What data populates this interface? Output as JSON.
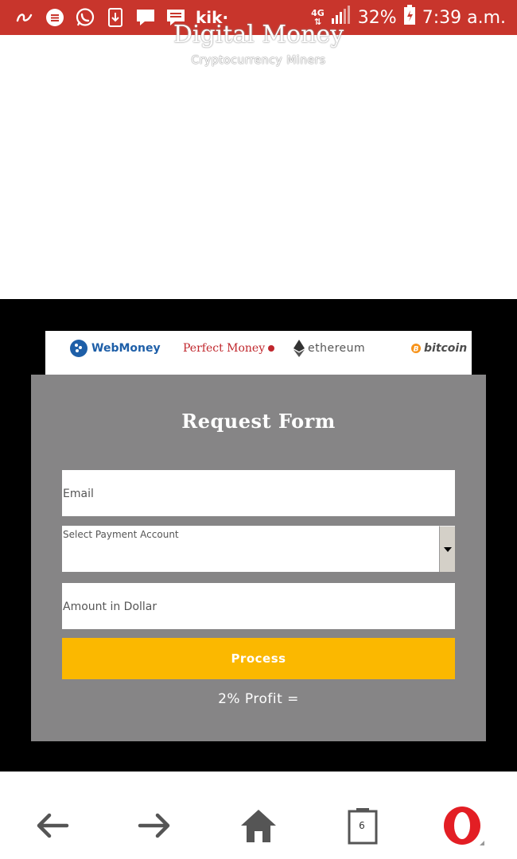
{
  "status_bar": {
    "kik_label": "kik·",
    "network": "4G",
    "battery": "32%",
    "time": "7:39 a.m."
  },
  "hero": {
    "title": "Digital Money",
    "subtitle": "Cryptocurrency Miners"
  },
  "logos": {
    "webmoney": "WebMoney",
    "perfect_money": "Perfect Money",
    "ethereum": "ethereum",
    "bitcoin": "bitcoin"
  },
  "form": {
    "title": "Request Form",
    "email_placeholder": "Email",
    "select_placeholder": "Select Payment Account",
    "amount_placeholder": "Amount in Dollar",
    "process_label": "Process",
    "profit_text": "2% Profit ="
  },
  "bottom_nav": {
    "tabs_count": "6"
  },
  "colors": {
    "status_bar": "#c8352c",
    "form_panel": "#868586",
    "process_button": "#fbb800",
    "section_background": "#000000"
  },
  "icons": [
    "launcher-icon",
    "messages-icon",
    "whatsapp-icon",
    "download-icon",
    "chat-icon",
    "notes-icon",
    "back-icon",
    "forward-icon",
    "home-icon",
    "tabs-icon",
    "opera-icon"
  ]
}
